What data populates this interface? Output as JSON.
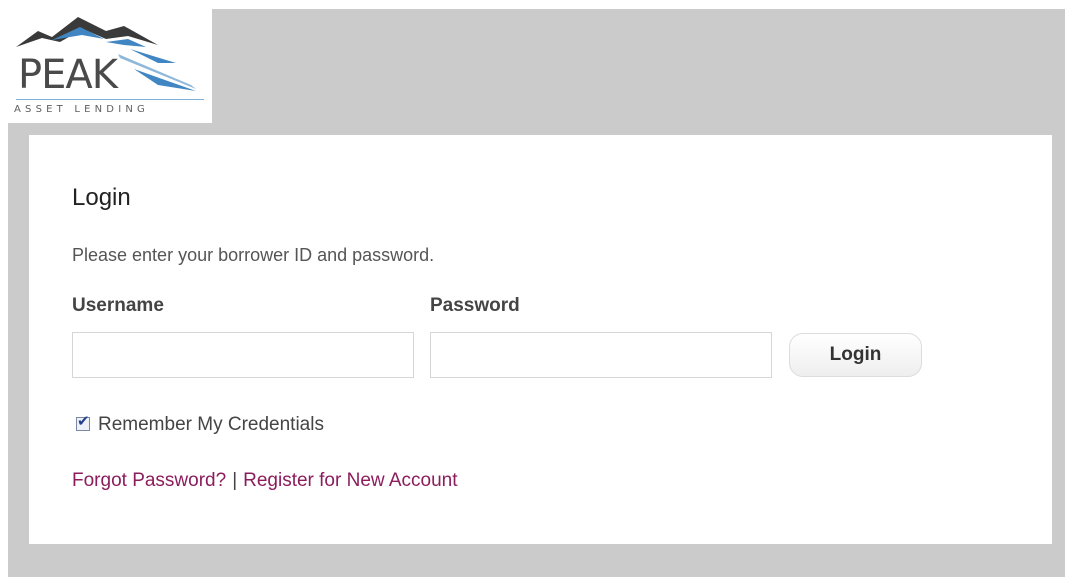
{
  "logo": {
    "name": "PEAK",
    "tagline": "ASSET LENDING",
    "mountain_colors": [
      "#3a3a3a",
      "#3f86c2",
      "#8fb7d9"
    ]
  },
  "login_card": {
    "title": "Login",
    "subtitle": "Please enter your borrower ID and password.",
    "username_label": "Username",
    "username_value": "",
    "password_label": "Password",
    "password_value": "",
    "login_button": "Login",
    "remember_checked": true,
    "remember_label": "Remember My Credentials",
    "forgot_password_link": "Forgot Password?",
    "separator": "|",
    "register_link": "Register for New Account"
  },
  "colors": {
    "page_background": "#cbcbcb",
    "card_background": "#ffffff",
    "link_color": "#8c1d5c"
  }
}
